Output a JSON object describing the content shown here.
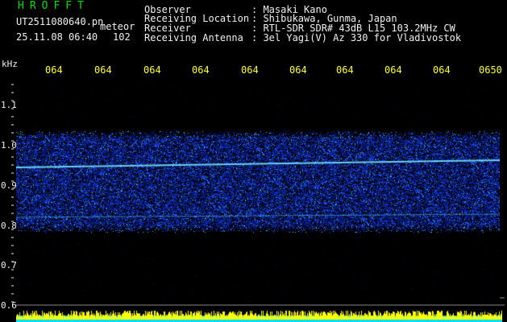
{
  "header": {
    "brand": "HROFFT",
    "filename": "UT2511080640.pn",
    "meteor_label": "meteor",
    "datetime": "25.11.08 06:40",
    "meteor_count": "102"
  },
  "info": {
    "rows": [
      {
        "label": "Observer",
        "value": ": Masaki Kano"
      },
      {
        "label": "Receiving Location",
        "value": ": Shibukawa, Gunma, Japan"
      },
      {
        "label": "Receiver",
        "value": ": RTL-SDR SDR# 43dB L15 103.2MHz CW"
      },
      {
        "label": "Receiving Antenna",
        "value": ": 3el Yagi(V) Az 330 for Vladivostok"
      }
    ]
  },
  "axis": {
    "y_unit": "kHz",
    "y_ticks": [
      "1.1",
      "1.0",
      "0.9",
      "0.8",
      "0.7",
      "0.6"
    ],
    "x_ticks": [
      "064",
      "064",
      "064",
      "064",
      "064",
      "064",
      "064",
      "064",
      "064",
      "0650"
    ]
  },
  "colors": {
    "background": "#000000",
    "text_white": "#f0f0f0",
    "text_yellow": "#ffff33",
    "brand_green": "#00e000",
    "noise_dark": "#00208c",
    "noise_mid": "#2040ff",
    "noise_bright": "#40c8ff",
    "amplitude_cyan": "#00e0ff",
    "amplitude_yellow": "#ffff00"
  }
}
